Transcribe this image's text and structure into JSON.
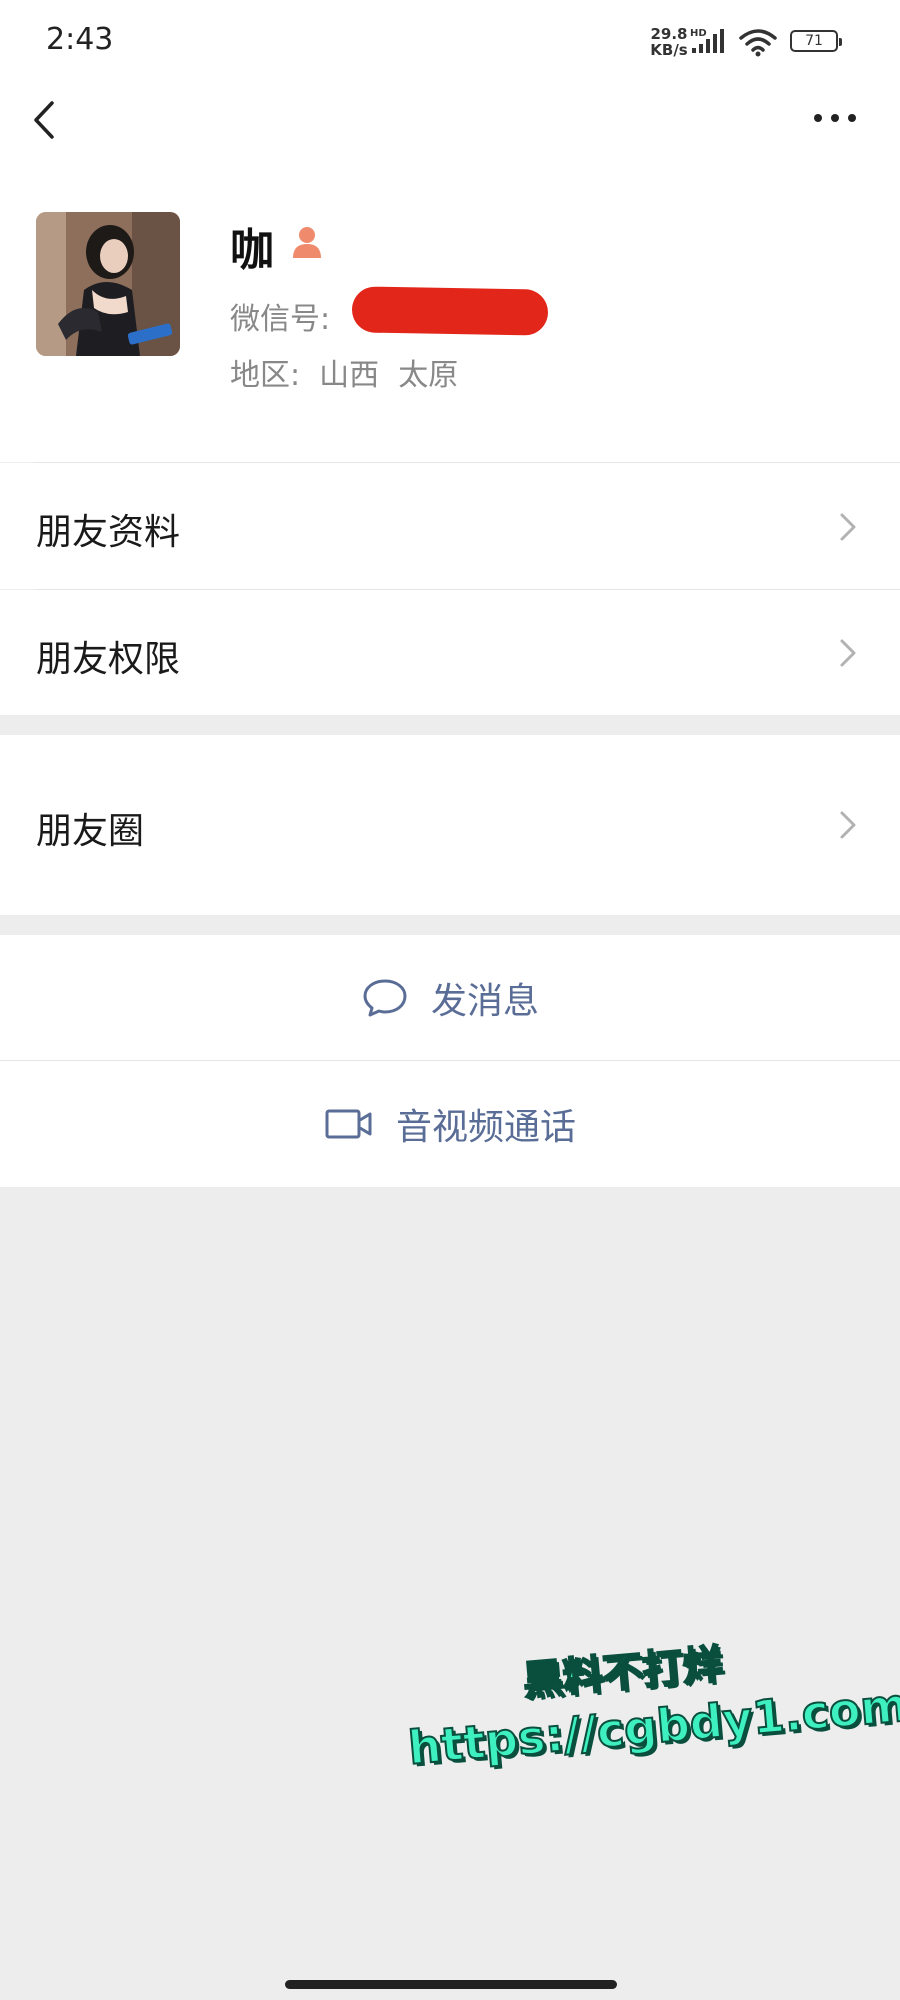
{
  "status_bar": {
    "time": "2:43",
    "net_speed_value": "29.8",
    "net_speed_unit": "KB/s",
    "network_label": "HD",
    "battery": "71"
  },
  "profile": {
    "name": "咖",
    "wechat_id_label": "微信号:",
    "region": "地区:  山西  太原",
    "redaction_color": "#e2261a"
  },
  "menu": {
    "friend_info": "朋友资料",
    "friend_permissions": "朋友权限",
    "moments": "朋友圈"
  },
  "actions": {
    "send_message": "发消息",
    "voice_video_call": "音视频通话",
    "accent_color": "#5a6d96"
  },
  "watermark": {
    "line1": "黑料不打烊",
    "line2": "https://cgbdy1.com"
  },
  "icons": {
    "back": "chevron-left-icon",
    "more": "ellipsis-icon",
    "gender": "female-icon",
    "message": "speech-bubble-icon",
    "video": "video-camera-icon",
    "chevron": "chevron-right-icon"
  }
}
